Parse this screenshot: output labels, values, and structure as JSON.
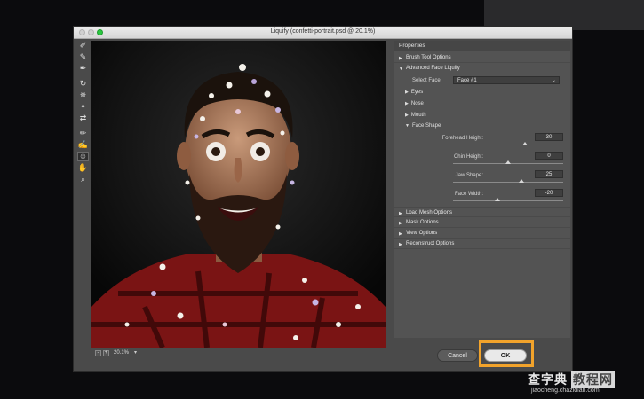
{
  "window": {
    "title": "Liquify (confetti-portrait.psd @ 20.1%)"
  },
  "toolbar": {
    "tools": [
      "forward-warp-icon",
      "reconstruct-icon",
      "smooth-icon",
      "twirl-icon",
      "pucker-icon",
      "bloat-icon",
      "push-left-icon",
      "freeze-mask-icon",
      "thaw-mask-icon",
      "face-tool-icon",
      "hand-icon",
      "zoom-icon"
    ]
  },
  "canvas": {
    "zoom": "20.1%",
    "zoom_out": "-",
    "zoom_in": "+"
  },
  "panel": {
    "title": "Properties",
    "sections": {
      "brush": "Brush Tool Options",
      "face": "Advanced Face Liquify",
      "load_mesh": "Load Mesh Options",
      "mask": "Mask Options",
      "view": "View Options",
      "reconstruct": "Reconstruct Options"
    },
    "select_face_label": "Select Face:",
    "select_face_value": "Face #1",
    "subsections": {
      "eyes": "Eyes",
      "nose": "Nose",
      "mouth": "Mouth",
      "face_shape": "Face Shape"
    },
    "sliders": [
      {
        "label": "Forehead Height:",
        "value": "30",
        "level": 0.65
      },
      {
        "label": "Chin Height:",
        "value": "0",
        "level": 0.5
      },
      {
        "label": "Jaw Shape:",
        "value": "25",
        "level": 0.62
      },
      {
        "label": "Face Width:",
        "value": "-20",
        "level": 0.4
      }
    ]
  },
  "buttons": {
    "cancel": "Cancel",
    "ok": "OK"
  },
  "watermark": {
    "brand": "查字典",
    "section": "教程网",
    "url": "jiaocheng.chazidian.com"
  },
  "colors": {
    "highlight": "#f2a32b",
    "panel": "#535353",
    "window": "#4a4a4a"
  }
}
